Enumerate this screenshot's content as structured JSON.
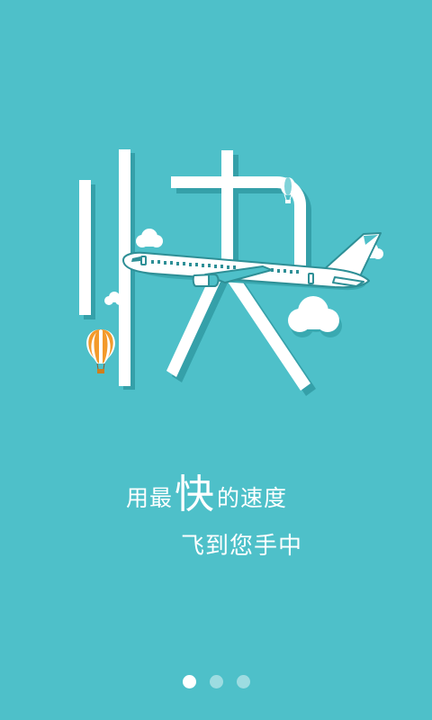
{
  "hero": {
    "glyph": "快",
    "colors": {
      "background": "#4ec0c9",
      "stroke_shadow": "#35a0a9",
      "plane_outline": "#2e8f96",
      "balloon_orange": "#f39a2b",
      "balloon_small": "#7fd3d9"
    }
  },
  "tagline": {
    "line1_before": "用最",
    "line1_emphasis": "快",
    "line1_after": "的速度",
    "line2": "飞到您手中"
  },
  "pager": {
    "total": 3,
    "active_index": 0
  }
}
